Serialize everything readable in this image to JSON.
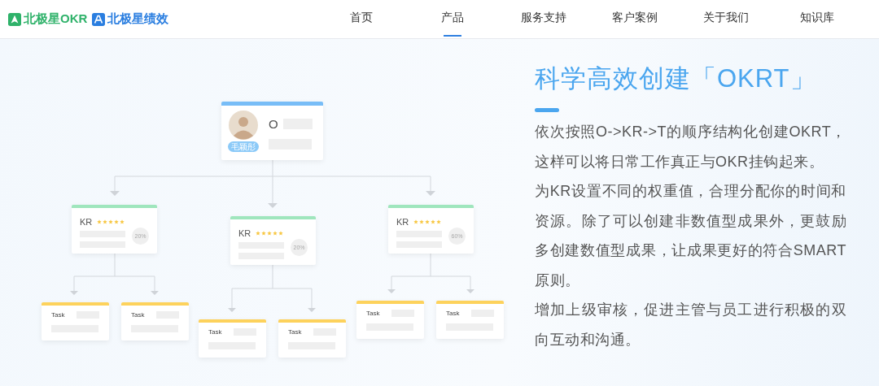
{
  "header": {
    "logos": [
      {
        "text": "北极星OKR",
        "kind": "okr"
      },
      {
        "text": "北极星绩效",
        "kind": "perf"
      }
    ],
    "nav": [
      {
        "label": "首页",
        "selected": false
      },
      {
        "label": "产品",
        "selected": true
      },
      {
        "label": "服务支持",
        "selected": false
      },
      {
        "label": "客户案例",
        "selected": false
      },
      {
        "label": "关于我们",
        "selected": false
      },
      {
        "label": "知识库",
        "selected": false
      }
    ]
  },
  "diagram": {
    "objective": {
      "label": "O",
      "owner": "毛颖彤"
    },
    "key_results": [
      {
        "label": "KR",
        "stars": 5,
        "weight": "20%",
        "tasks": [
          {
            "label": "Task"
          },
          {
            "label": "Task"
          }
        ]
      },
      {
        "label": "KR",
        "stars": 5,
        "weight": "20%",
        "tasks": [
          {
            "label": "Task"
          },
          {
            "label": "Task"
          }
        ]
      },
      {
        "label": "KR",
        "stars": 5,
        "weight": "60%",
        "tasks": [
          {
            "label": "Task"
          },
          {
            "label": "Task"
          }
        ]
      }
    ]
  },
  "feature": {
    "title": "科学高效创建「OKRT」",
    "paragraphs": [
      "依次按照O->KR->T的顺序结构化创建OKRT，这样可以将日常工作真正与OKR挂钩起来。",
      "为KR设置不同的权重值，合理分配你的时间和资源。除了可以创建非数值型成果外，更鼓励多创建数值型成果，让成果更好的符合SMART原则。",
      "增加上级审核，促进主管与员工进行积极的双向互动和沟通。"
    ]
  }
}
